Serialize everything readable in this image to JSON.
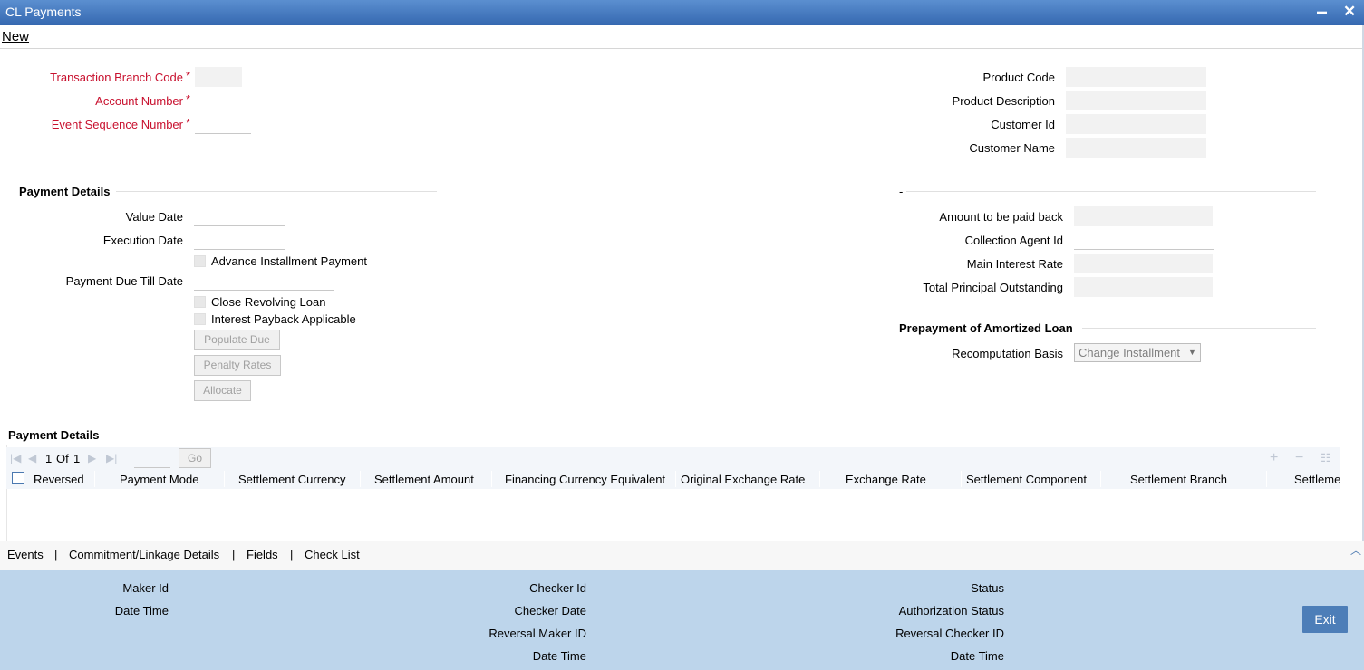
{
  "window": {
    "title": "CL Payments",
    "minimize": "▬",
    "close": "✕"
  },
  "menu": {
    "new": "New"
  },
  "header_left": {
    "branch_code_label": "Transaction Branch Code",
    "account_number_label": "Account Number",
    "event_seq_label": "Event Sequence Number",
    "required_mark": "*"
  },
  "header_right": {
    "product_code_label": "Product Code",
    "product_desc_label": "Product Description",
    "customer_id_label": "Customer Id",
    "customer_name_label": "Customer Name"
  },
  "payment_details": {
    "section_title": "Payment Details",
    "value_date_label": "Value Date",
    "execution_date_label": "Execution Date",
    "advance_installment_label": "Advance Installment Payment",
    "payment_due_till_label": "Payment Due Till Date",
    "close_revolving_label": "Close Revolving Loan",
    "interest_payback_label": "Interest Payback Applicable",
    "populate_due_btn": "Populate Due",
    "penalty_rates_btn": "Penalty Rates",
    "allocate_btn": "Allocate"
  },
  "right_section": {
    "section_title": "-",
    "amount_paid_back_label": "Amount to be paid back",
    "collection_agent_label": "Collection Agent Id",
    "main_interest_label": "Main Interest Rate",
    "total_principal_label": "Total Principal Outstanding"
  },
  "prepayment": {
    "section_title": "Prepayment of Amortized Loan",
    "recomputation_label": "Recomputation Basis",
    "recomputation_value": "Change Installment"
  },
  "grid": {
    "title": "Payment Details",
    "page_current": "1",
    "page_of": "Of",
    "page_total": "1",
    "go_btn": "Go",
    "columns": [
      "Reversed",
      "Payment Mode",
      "Settlement Currency",
      "Settlement Amount",
      "Financing Currency Equivalent",
      "Original Exchange Rate",
      "Exchange Rate",
      "Settlement Component",
      "Settlement Branch",
      "Settleme"
    ]
  },
  "bottom_tabs": [
    "Events",
    "Commitment/Linkage Details",
    "Fields",
    "Check List"
  ],
  "footer": {
    "maker_id_label": "Maker Id",
    "date_time_label": "Date Time",
    "checker_id_label": "Checker Id",
    "checker_date_label": "Checker Date",
    "reversal_maker_label": "Reversal Maker ID",
    "date_time2_label": "Date Time",
    "status_label": "Status",
    "auth_status_label": "Authorization Status",
    "reversal_checker_label": "Reversal Checker ID",
    "date_time3_label": "Date Time",
    "exit_btn": "Exit"
  },
  "colors": {
    "title_bar": "#3568b0",
    "required_label": "#c8102e",
    "footer_bg": "#bdd5eb",
    "exit_btn": "#4d7eb8"
  }
}
